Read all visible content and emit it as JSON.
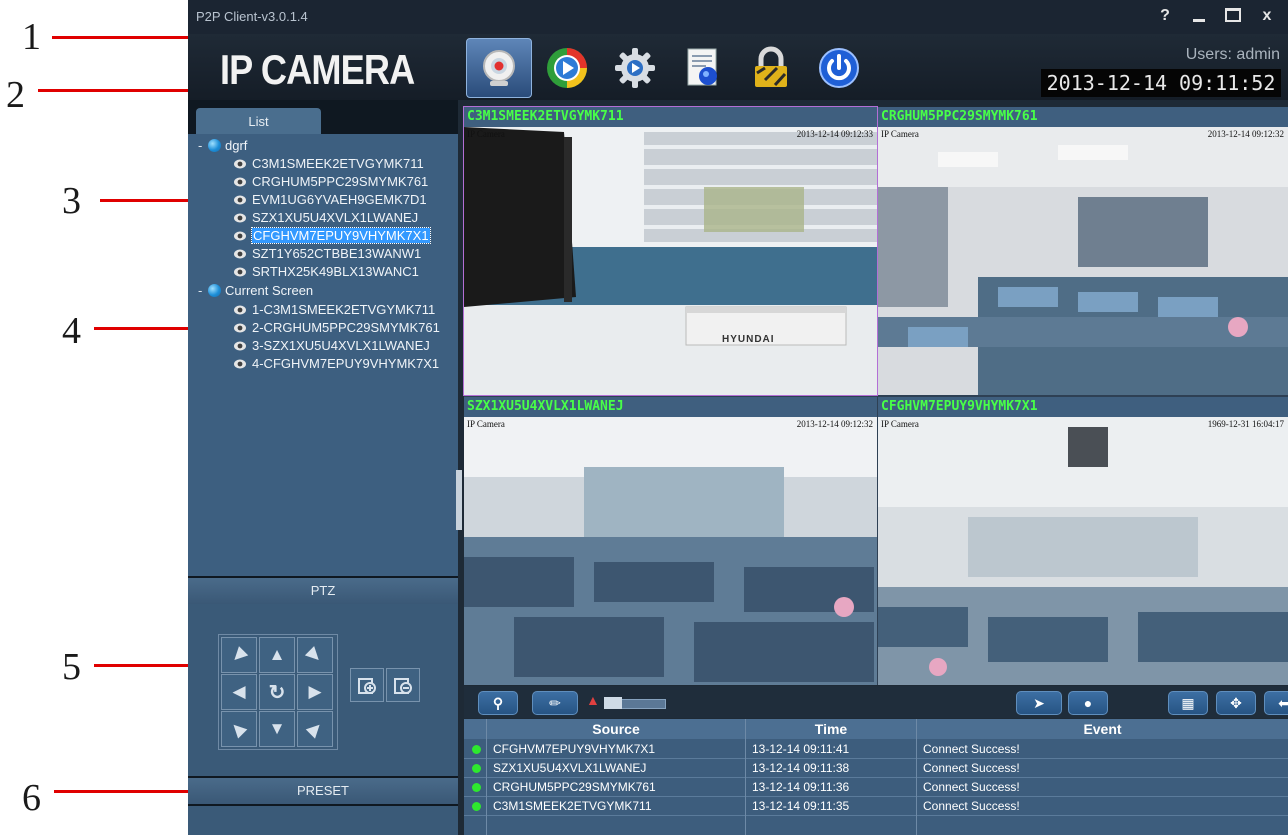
{
  "window": {
    "title": "P2P Client-v3.0.1.4",
    "buttons": [
      "?",
      "_",
      "□",
      "x"
    ]
  },
  "header": {
    "logo": "IP CAMERA",
    "users_text": "Users: admin",
    "datetime": "2013-12-14 09:11:52",
    "toolbar_icons": [
      "camera-icon",
      "playback-icon",
      "settings-icon",
      "log-icon",
      "lock-icon",
      "power-icon"
    ]
  },
  "left_panel": {
    "list_tab": "List",
    "groups": [
      {
        "name": "dgrf",
        "items": [
          "C3M1SMEEK2ETVGYMK711",
          "CRGHUM5PPC29SMYMK761",
          "EVM1UG6YVAEH9GEMK7D1",
          "SZX1XU5U4XVLX1LWANEJ",
          "CFGHVM7EPUY9VHYMK7X1",
          "SZT1Y652CTBBE13WANW1",
          "SRTHX25K49BLX13WANC1"
        ],
        "selected_index": 4
      },
      {
        "name": "Current Screen",
        "items": [
          "1-C3M1SMEEK2ETVGYMK711",
          "2-CRGHUM5PPC29SMYMK761",
          "3-SZX1XU5U4XVLX1LWANEJ",
          "4-CFGHVM7EPUY9VHYMK7X1"
        ]
      }
    ],
    "ptz_label": "PTZ",
    "preset_label": "PRESET"
  },
  "video_panels": [
    {
      "title": "C3M1SMEEK2ETVGYMK711",
      "osd_name": "IP Camera",
      "osd_time": "2013-12-14 09:12:33",
      "brand_label": "HYUNDAI"
    },
    {
      "title": "CRGHUM5PPC29SMYMK761",
      "osd_name": "IP Camera",
      "osd_time": "2013-12-14 09:12:32"
    },
    {
      "title": "SZX1XU5U4XVLX1LWANEJ",
      "osd_name": "IP Camera",
      "osd_time": "2013-12-14 09:12:32"
    },
    {
      "title": "CFGHVM7EPUY9VHYMK7X1",
      "osd_name": "IP Camera",
      "osd_time": "1969-12-31 16:04:17"
    }
  ],
  "events": {
    "columns": [
      "Source",
      "Time",
      "Event"
    ],
    "rows": [
      {
        "source": "CFGHVM7EPUY9VHYMK7X1",
        "time": "13-12-14 09:11:41",
        "event": "Connect Success!"
      },
      {
        "source": "SZX1XU5U4XVLX1LWANEJ",
        "time": "13-12-14 09:11:38",
        "event": "Connect Success!"
      },
      {
        "source": "CRGHUM5PPC29SMYMK761",
        "time": "13-12-14 09:11:36",
        "event": "Connect Success!"
      },
      {
        "source": "C3M1SMEEK2ETVGYMK711",
        "time": "13-12-14 09:11:35",
        "event": "Connect Success!"
      }
    ]
  },
  "annotations": [
    "1",
    "2",
    "3",
    "4",
    "5",
    "6"
  ],
  "colors": {
    "title_green": "#48ff48",
    "arrow_red": "#e00000",
    "selection_blue": "#3399ff",
    "active_border": "#b36fd6"
  }
}
